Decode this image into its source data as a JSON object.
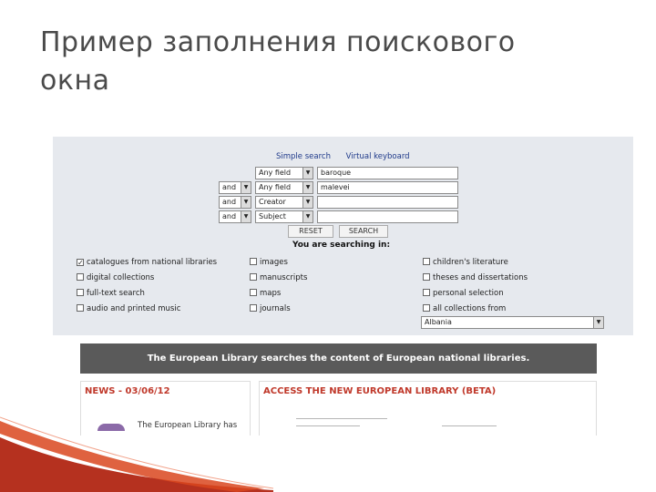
{
  "slide": {
    "title": "Пример заполнения поискового\nокна"
  },
  "search_panel": {
    "links": {
      "simple": "Simple search",
      "keyboard": "Virtual keyboard"
    },
    "rows": [
      {
        "bool": "",
        "field": "Any field",
        "value": "baroque"
      },
      {
        "bool": "and",
        "field": "Any field",
        "value": "malevei"
      },
      {
        "bool": "and",
        "field": "Creator",
        "value": ""
      },
      {
        "bool": "and",
        "field": "Subject",
        "value": ""
      }
    ],
    "reset_label": "RESET",
    "search_label": "SEARCH",
    "searching_in": "You are searching in:",
    "collections": [
      {
        "label": "catalogues from national libraries",
        "checked": true
      },
      {
        "label": "digital collections",
        "checked": false
      },
      {
        "label": "full-text search",
        "checked": false
      },
      {
        "label": "audio and printed music",
        "checked": false
      },
      {
        "label": "images",
        "checked": false
      },
      {
        "label": "manuscripts",
        "checked": false
      },
      {
        "label": "maps",
        "checked": false
      },
      {
        "label": "journals",
        "checked": false
      },
      {
        "label": "children's literature",
        "checked": false
      },
      {
        "label": "theses and dissertations",
        "checked": false
      },
      {
        "label": "personal selection",
        "checked": false
      },
      {
        "label": "all collections from",
        "checked": false
      }
    ],
    "country": "Albania"
  },
  "library": {
    "banner": "The European Library searches the content of European national libraries.",
    "news_heading": "NEWS - 03/06/12",
    "news_snippet": "The European Library has",
    "access_heading": "ACCESS THE NEW EUROPEAN LIBRARY (BETA)"
  },
  "colors": {
    "title": "#4a4a4a",
    "panel_bg": "#e6e9ee",
    "banner_bg": "#5a5a5a",
    "accent_red": "#c0392b",
    "link_blue": "#1f3a8a"
  }
}
